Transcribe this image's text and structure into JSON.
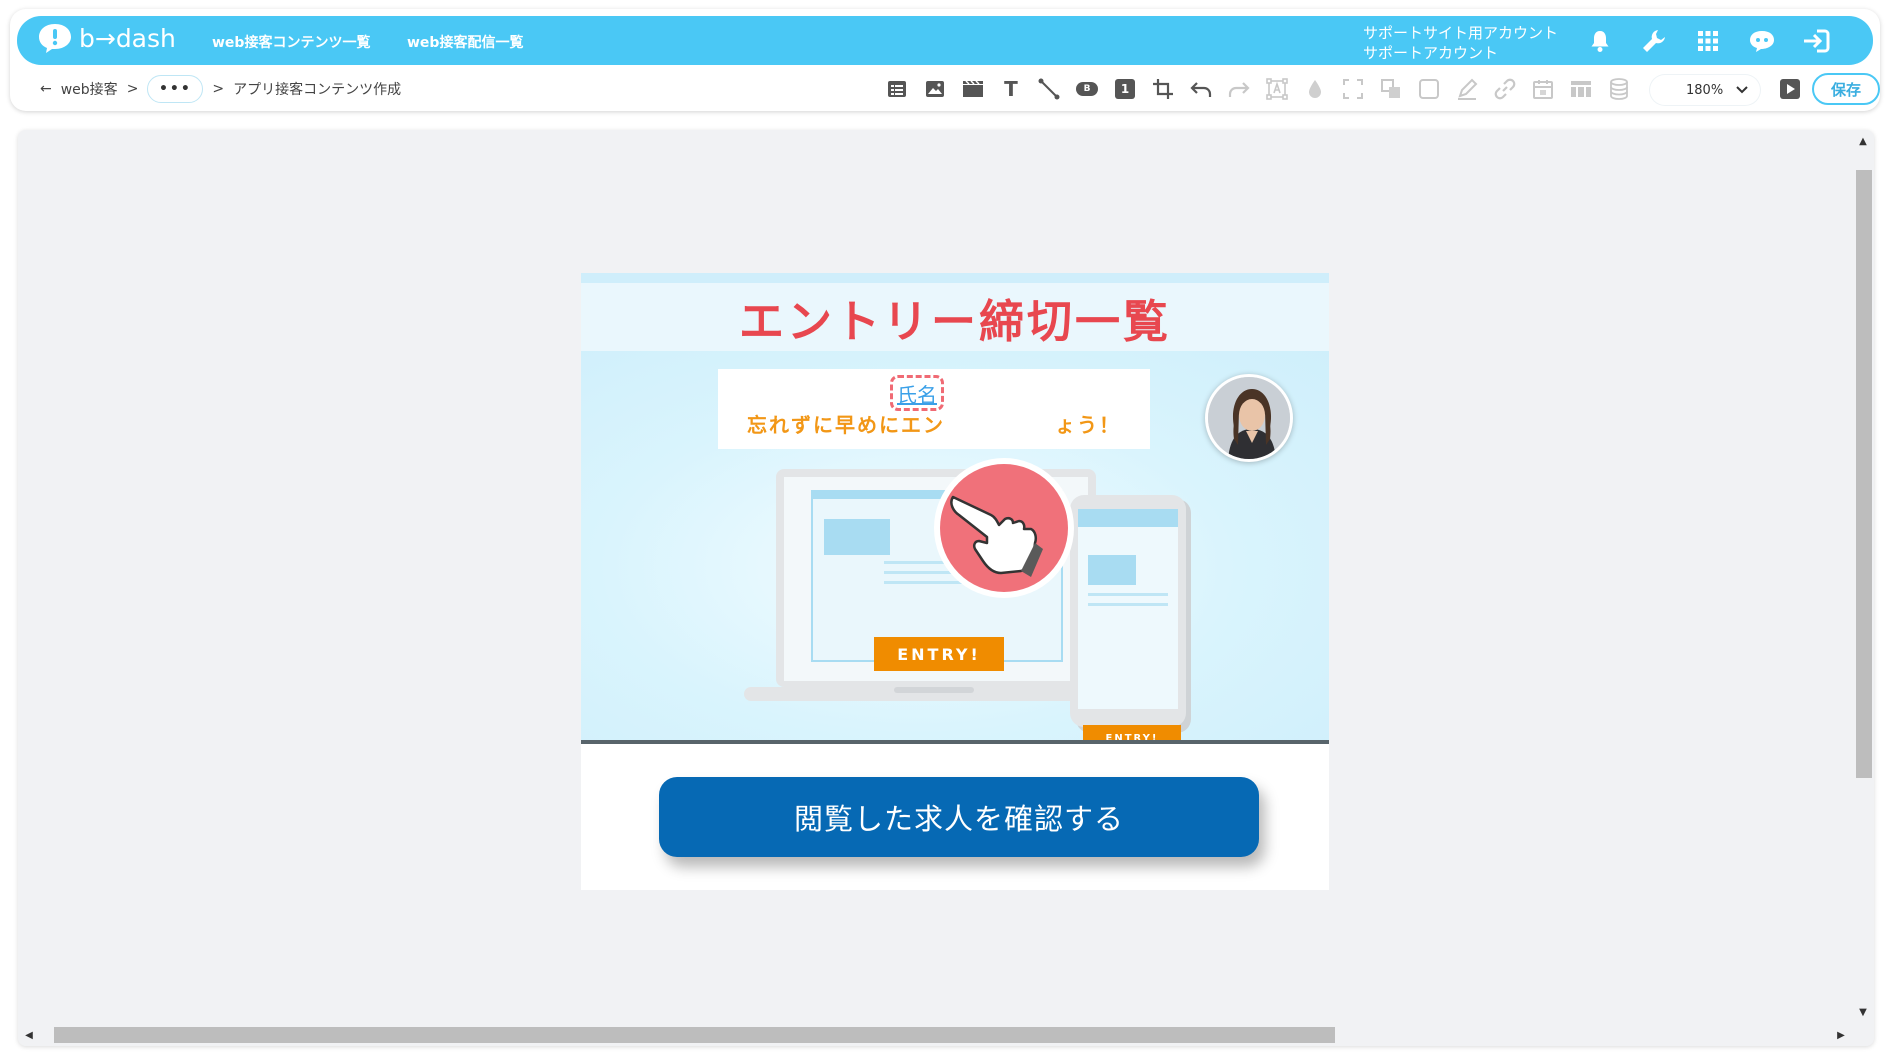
{
  "app": {
    "logo_text": "b→dash",
    "nav": [
      "web接客コンテンツ一覧",
      "web接客配信一覧"
    ],
    "account_line1": "サポートサイト用アカウント",
    "account_line2": "サポートアカウント",
    "header_icons": [
      "bell-icon",
      "wrench-icon",
      "grid-icon",
      "chat-bot-icon",
      "logout-icon"
    ]
  },
  "breadcrumb": {
    "back_icon": "←",
    "root": "web接客",
    "separator": ">",
    "collapsed": "•••",
    "current": "アプリ接客コンテンツ作成"
  },
  "toolbar": {
    "tools": [
      "layout-icon",
      "image-icon",
      "video-icon",
      "text-icon",
      "line-icon",
      "button-icon",
      "number-icon",
      "crop-icon",
      "undo-icon",
      "redo-icon",
      "text-box-icon",
      "fill-icon",
      "frame-icon",
      "group-icon",
      "shape-icon",
      "pen-icon",
      "link-icon",
      "calendar-icon",
      "table-icon",
      "database-icon"
    ],
    "number_badge": "1",
    "text_glyph": "T",
    "button_glyph": "B",
    "zoom": "180%",
    "preview_icon": "play-icon",
    "save_label": "保存"
  },
  "content": {
    "title": "エントリー締切一覧",
    "name_placeholder": "氏名",
    "message": "忘れずに早めにエン　　　　　ょう！",
    "laptop_button": "ENTRY!",
    "phone_button": "ENTRY!",
    "cta_label": "閲覧した求人を確認する"
  },
  "colors": {
    "brand": "#4ac8f5",
    "title_red": "#e8474f",
    "message_orange": "#f29716",
    "cta_blue": "#0669b4",
    "entry_orange": "#f08c00"
  }
}
